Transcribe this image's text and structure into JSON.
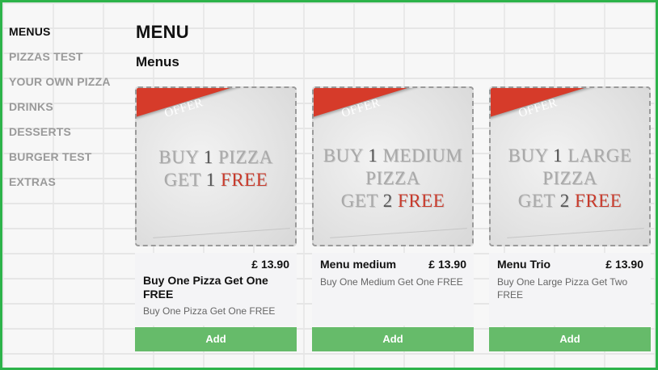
{
  "sidebar": {
    "items": [
      {
        "label": "MENUS",
        "active": true
      },
      {
        "label": "PIZZAS TEST",
        "active": false
      },
      {
        "label": "YOUR OWN PIZZA",
        "active": false
      },
      {
        "label": "DRINKS",
        "active": false
      },
      {
        "label": "DESSERTS",
        "active": false
      },
      {
        "label": "BURGER TEST",
        "active": false
      },
      {
        "label": "EXTRAS",
        "active": false
      }
    ]
  },
  "main": {
    "title": "MENU",
    "section_title": "Menus"
  },
  "cards": [
    {
      "offer_badge": "OFFER",
      "offer_line1_a": "BUY ",
      "offer_line1_num": "1",
      "offer_line1_b": " PIZZA",
      "offer_line2_a": "GET ",
      "offer_line2_num": "1",
      "offer_line2_red": " FREE",
      "name": "Buy One Pizza Get One FREE",
      "price": "£ 13.90",
      "description": "Buy One Pizza Get One FREE",
      "add_label": "Add"
    },
    {
      "offer_badge": "OFFER",
      "offer_line1_a": "BUY ",
      "offer_line1_num": "1",
      "offer_line1_b": " MEDIUM",
      "offer_line_mid": "PIZZA",
      "offer_line2_a": "GET ",
      "offer_line2_num": "2",
      "offer_line2_red": " FREE",
      "name": "Menu medium",
      "price": "£ 13.90",
      "description": "Buy One Medium Get One FREE",
      "add_label": "Add"
    },
    {
      "offer_badge": "OFFER",
      "offer_line1_a": "BUY ",
      "offer_line1_num": "1",
      "offer_line1_b": " LARGE",
      "offer_line_mid": "PIZZA",
      "offer_line2_a": "GET ",
      "offer_line2_num": "2",
      "offer_line2_red": " FREE",
      "name": "Menu Trio",
      "price": "£ 13.90",
      "description": "Buy One Large Pizza Get Two FREE",
      "add_label": "Add"
    }
  ],
  "colors": {
    "frame_border": "#2db34a",
    "add_button": "#66bb6a",
    "offer_ribbon": "#d63b2a",
    "sidebar_inactive": "#9a9a9a",
    "sidebar_active": "#111111"
  }
}
